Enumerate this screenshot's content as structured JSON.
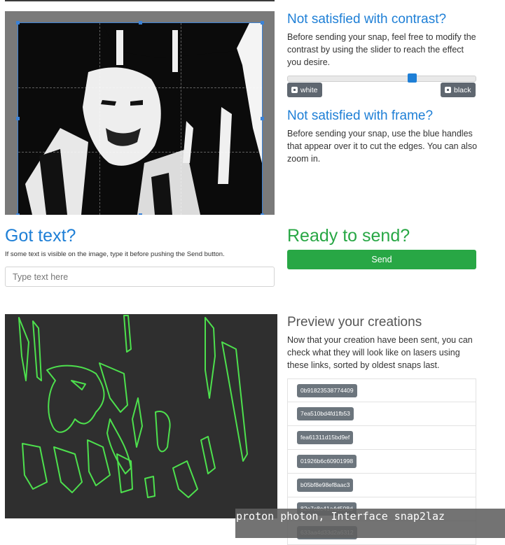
{
  "contrast": {
    "title": "Not satisfied with contrast?",
    "description": "Before sending your snap, feel free to modify the contrast by using the slider to reach the effect you desire.",
    "slider_value": 0.66,
    "white_label": "white",
    "black_label": "black"
  },
  "frame": {
    "title": "Not satisfied with frame?",
    "description": "Before sending your snap, use the blue handles that appear over it to cut the edges. You can also zoom in."
  },
  "text_section": {
    "title": "Got text?",
    "note": "If some text is visible on the image, type it before pushing the Send button.",
    "input_placeholder": "Type text here",
    "input_value": ""
  },
  "send_section": {
    "title": "Ready to send?",
    "button_label": "Send"
  },
  "preview": {
    "title": "Preview your creations",
    "description": "Now that your creation have been sent, you can check what they will look like on lasers using these links, sorted by oldest snaps last.",
    "links": [
      "0b91823538774409",
      "7ea510bd4fd1fb53",
      "fea61311d15bd9ef",
      "01926b6c60901998",
      "b05bf8e98ef8aac3",
      "82e7c8c41a4d508d",
      "633aa4d33d2a6312"
    ]
  },
  "overlay": {
    "caption": "proton photon, Interface snap2laz"
  },
  "colors": {
    "accent_blue": "#1e7fd6",
    "send_green": "#28a745",
    "laser_green": "#4de04d",
    "badge_gray": "#6c757d"
  }
}
